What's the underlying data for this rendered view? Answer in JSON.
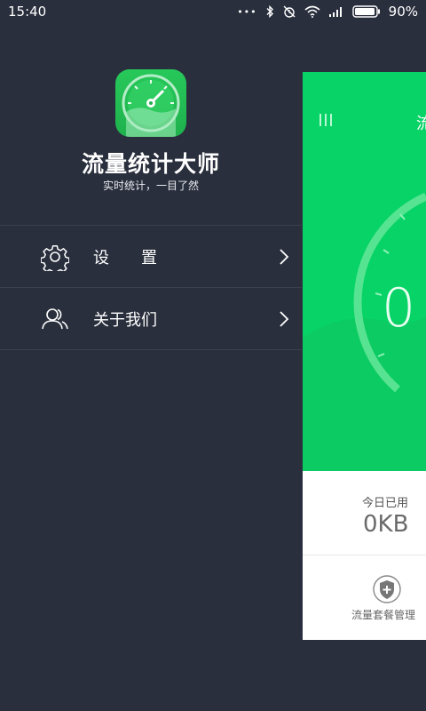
{
  "status_bar": {
    "time": "15:40",
    "dots": "•••",
    "battery": "90%"
  },
  "drawer": {
    "app_name": "流量统计大师",
    "slogan": "实时统计，一目了然",
    "menu": [
      {
        "label": "设　　置",
        "icon": "gear-icon"
      },
      {
        "label": "关于我们",
        "icon": "users-icon"
      }
    ]
  },
  "card": {
    "title": "流",
    "gauge_value": "0",
    "today_label": "今日已用",
    "today_value": "0KB",
    "plan_button_label": "流量套餐管理"
  },
  "colors": {
    "drawer_bg": "#2a2f3d",
    "accent_green": "#07d366",
    "logo_green": "#27c85a"
  }
}
